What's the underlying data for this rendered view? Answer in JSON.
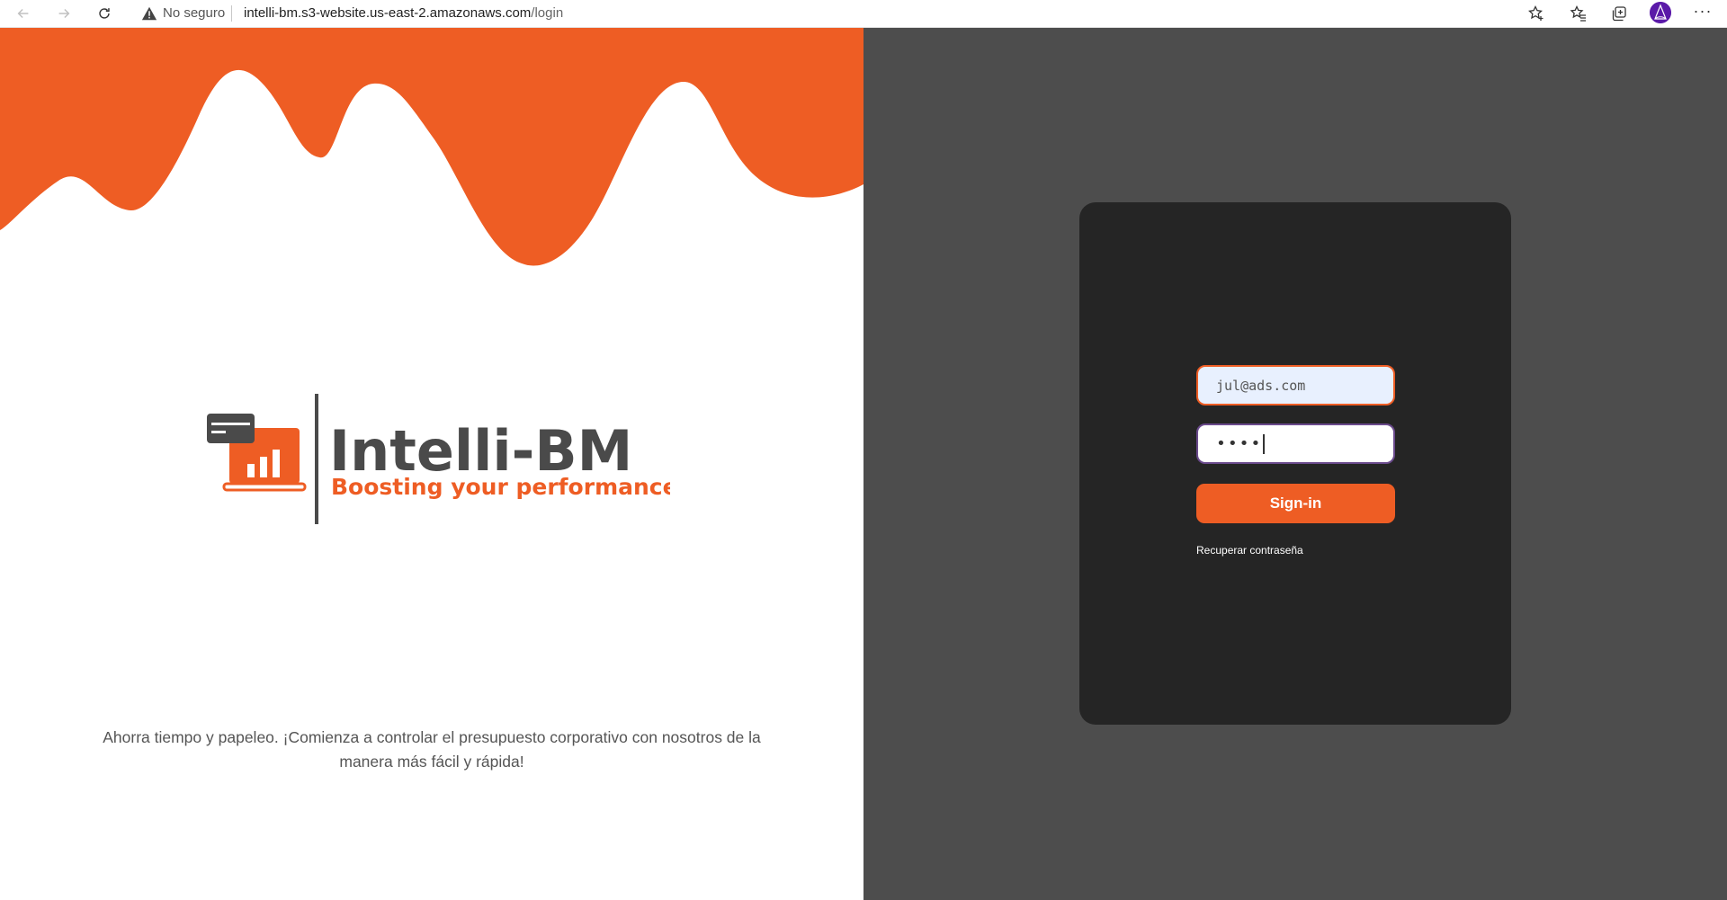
{
  "browser": {
    "security_label": "No seguro",
    "url_host": "intelli-bm.s3-website.us-east-2.amazonaws.com",
    "url_path": "/login"
  },
  "brand": {
    "name": "Intelli-BM",
    "slogan": "Boosting your performance",
    "accent_color": "#ee5d24",
    "dark_color": "#4a4a4a"
  },
  "tagline": "Ahorra tiempo y papeleo. ¡Comienza a controlar el presupuesto corporativo con nosotros de la manera más fácil y rápida!",
  "login": {
    "email_value": "jul@ads.com",
    "password_mask": "••••",
    "signin_label": "Sign-in",
    "recover_label": "Recuperar contraseña"
  }
}
